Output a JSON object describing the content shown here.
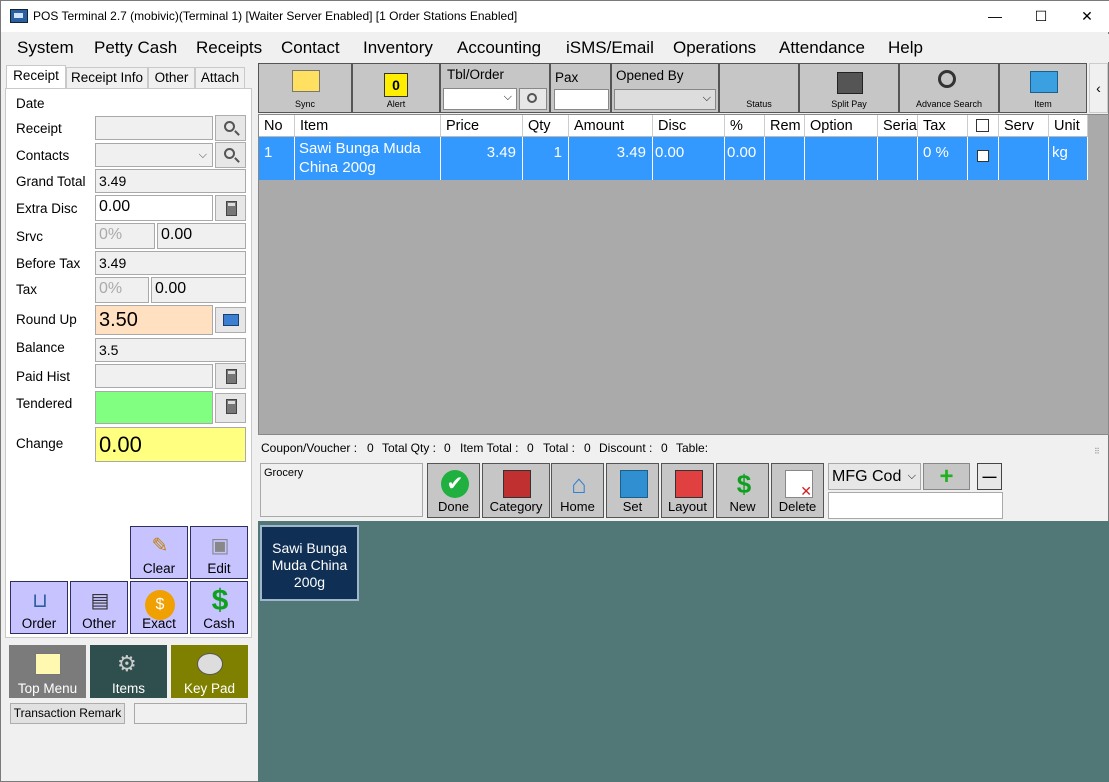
{
  "window": {
    "title": "POS Terminal 2.7 (mobivic)(Terminal 1) [Waiter Server Enabled] [1 Order Stations Enabled]",
    "minimize": "—",
    "maximize": "☐",
    "close": "✕"
  },
  "menu": [
    "System",
    "Petty Cash",
    "Receipts",
    "Contact",
    "Inventory",
    "Accounting",
    "iSMS/Email",
    "Operations",
    "Attendance",
    "Help"
  ],
  "left_tabs": [
    "Receipt",
    "Receipt Info",
    "Other",
    "Attach"
  ],
  "receipt": {
    "labels": {
      "date": "Date",
      "receipt": "Receipt",
      "contacts": "Contacts",
      "grand_total": "Grand Total",
      "extra_disc": "Extra Disc",
      "srvc": "Srvc",
      "before_tax": "Before Tax",
      "tax": "Tax",
      "round_up": "Round Up",
      "balance": "Balance",
      "paid_hist": "Paid Hist",
      "tendered": "Tendered",
      "change": "Change"
    },
    "values": {
      "grand_total": "3.49",
      "extra_disc": "0.00",
      "srvc_pct": "0%",
      "srvc_amt": "0.00",
      "before_tax": "3.49",
      "tax_pct": "0%",
      "tax_amt": "0.00",
      "round_up": "3.50",
      "balance": "3.5",
      "change": "0.00"
    }
  },
  "action_buttons": {
    "clear": "Clear",
    "edit": "Edit",
    "order": "Order",
    "other": "Other",
    "exact": "Exact",
    "cash": "Cash"
  },
  "bottom_tiles": {
    "top_menu": "Top Menu",
    "items": "Items",
    "key_pad": "Key Pad",
    "transaction_remark": "Transaction Remark"
  },
  "toolbar": {
    "sync": "Sync",
    "alert": "Alert",
    "alert_count": "0",
    "tbl_order": "Tbl/Order",
    "pax": "Pax",
    "opened_by": "Opened By",
    "status": "Status",
    "split_pay": "Split Pay",
    "advance_search": "Advance Search",
    "item": "Item",
    "collapse": "‹"
  },
  "grid": {
    "columns": [
      "No",
      "Item",
      "Price",
      "Qty",
      "Amount",
      "Disc",
      "%",
      "Rem",
      "Option",
      "Seria",
      "Tax",
      "",
      "Serv",
      "Unit"
    ],
    "rows": [
      {
        "no": "1",
        "item": "Sawi Bunga Muda China 200g",
        "price": "3.49",
        "qty": "1",
        "amount": "3.49",
        "disc": "0.00",
        "pct": "0.00",
        "rem": "",
        "option": "",
        "serial": "",
        "tax": "0 %",
        "serv": "",
        "unit": "kg"
      }
    ]
  },
  "status_line": {
    "coupon": "Coupon/Voucher :",
    "coupon_val": "0",
    "total_qty": "Total Qty :",
    "total_qty_val": "0",
    "item_total": "Item Total :",
    "item_total_val": "0",
    "total": "Total :",
    "total_val": "0",
    "discount": "Discount :",
    "discount_val": "0",
    "table": "Table:"
  },
  "category": {
    "current": "Grocery",
    "buttons": [
      "Done",
      "Category",
      "Home",
      "Set",
      "Layout",
      "New",
      "Delete"
    ],
    "mfg_select": "MFG Cod",
    "plus": "+",
    "minus": "—"
  },
  "items": [
    {
      "label": "Sawi Bunga Muda China 200g"
    }
  ],
  "colors": {
    "purple_button": "#c6c3ff",
    "grid_selected": "#3399ff",
    "item_area": "#517777",
    "round_up_bg": "#ffe0c0",
    "tendered_bg": "#80ff80",
    "change_bg": "#ffff80"
  }
}
